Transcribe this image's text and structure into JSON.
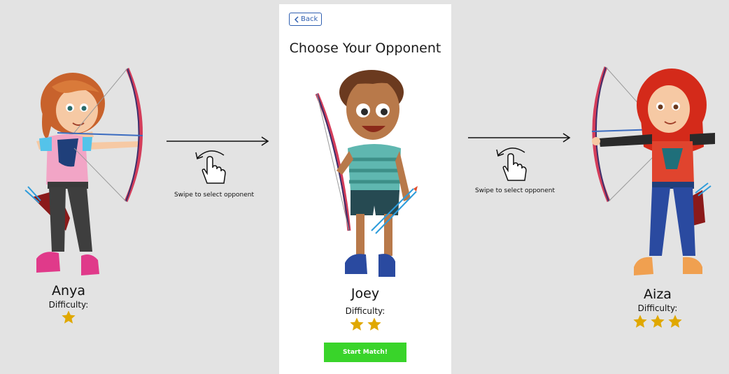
{
  "header": {
    "back_label": "Back",
    "title": "Choose Your Opponent"
  },
  "opponents": [
    {
      "name": "Anya",
      "difficulty_label": "Difficulty:",
      "stars": 1
    },
    {
      "name": "Joey",
      "difficulty_label": "Difficulty:",
      "stars": 2
    },
    {
      "name": "Aiza",
      "difficulty_label": "Difficulty:",
      "stars": 3
    }
  ],
  "swipe_hint": "Swipe to select opponent",
  "start_button": "Start Match!",
  "colors": {
    "background": "#e3e3e3",
    "panel": "#ffffff",
    "accent_green": "#39d42a",
    "back_blue": "#2f5fb0",
    "star_gold": "#e0a800"
  },
  "icons": [
    "chevron-left-icon",
    "swipe-hand-icon",
    "arrow-right-icon",
    "star-icon"
  ]
}
